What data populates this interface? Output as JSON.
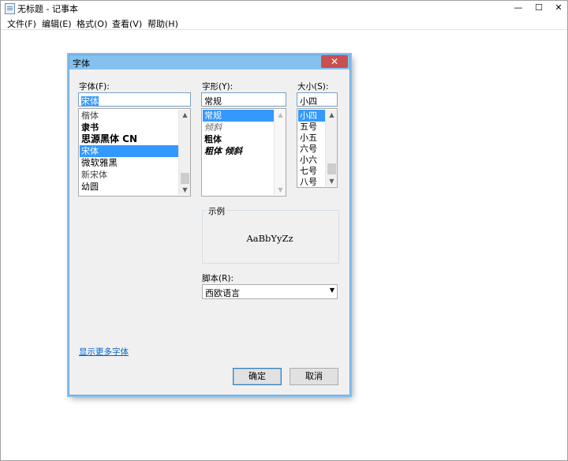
{
  "window": {
    "title": "无标题 - 记事本",
    "controls": {
      "minimize": "—",
      "maximize": "☐",
      "close": "✕"
    }
  },
  "menubar": [
    {
      "label": "文件(F)"
    },
    {
      "label": "编辑(E)"
    },
    {
      "label": "格式(O)"
    },
    {
      "label": "查看(V)"
    },
    {
      "label": "帮助(H)"
    }
  ],
  "dialog": {
    "title": "字体",
    "close": "✕",
    "font": {
      "label": "字体(F):",
      "value": "宋体",
      "items": [
        "楷体",
        "隶书",
        "思源黑体 CN",
        "宋体",
        "微软雅黑",
        "新宋体",
        "幼圆"
      ],
      "selected": "宋体"
    },
    "style": {
      "label": "字形(Y):",
      "value": "常规",
      "items": [
        "常规",
        "倾斜",
        "粗体",
        "粗体 倾斜"
      ],
      "selected": "常规"
    },
    "size": {
      "label": "大小(S):",
      "value": "小四",
      "items": [
        "小四",
        "五号",
        "小五",
        "六号",
        "小六",
        "七号",
        "八号"
      ],
      "selected": "小四"
    },
    "sample": {
      "label": "示例",
      "text": "AaBbYyZz"
    },
    "script": {
      "label": "脚本(R):",
      "value": "西欧语言"
    },
    "more_fonts_link": "显示更多字体",
    "ok": "确定",
    "cancel": "取消"
  }
}
